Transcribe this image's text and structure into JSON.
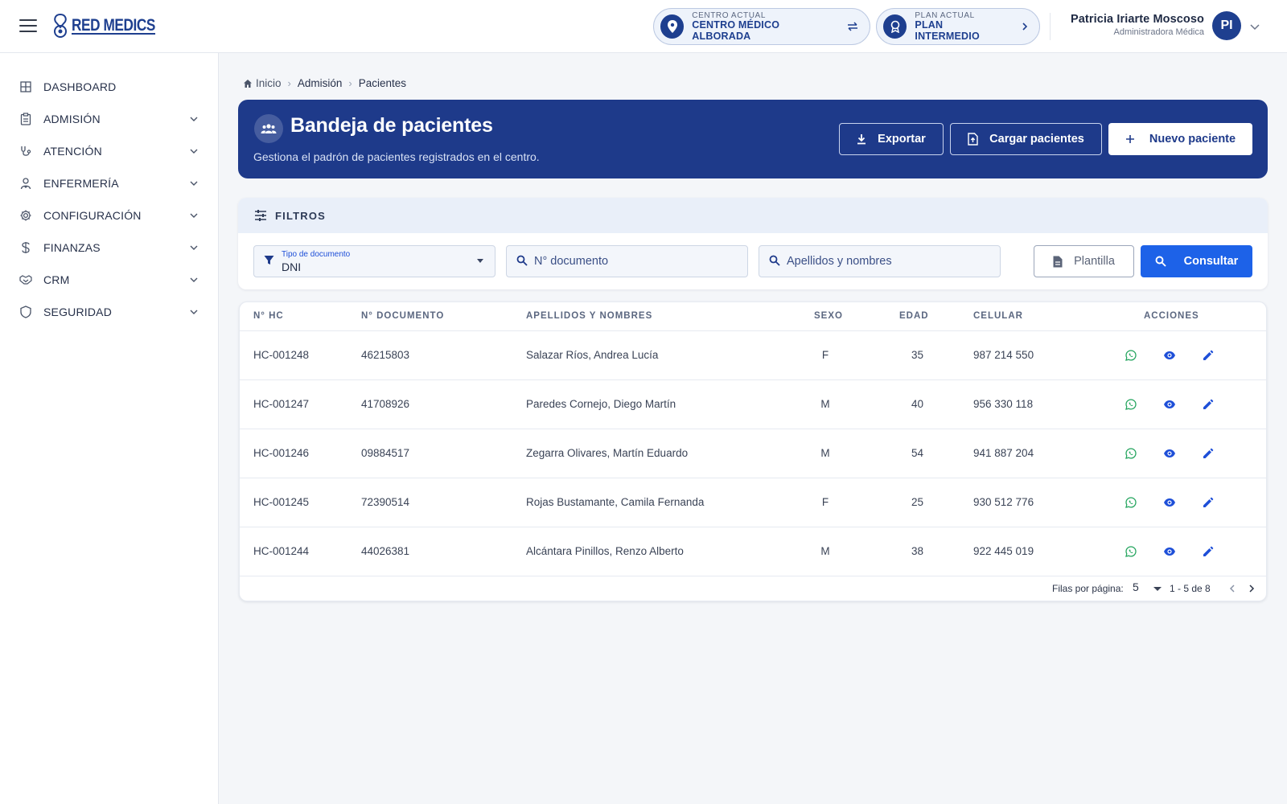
{
  "header": {
    "logo_text": "RED MEDICS",
    "center": {
      "label": "CENTRO ACTUAL",
      "value": "CENTRO MÉDICO ALBORADA"
    },
    "plan": {
      "label": "PLAN ACTUAL",
      "value": "PLAN INTERMEDIO"
    },
    "user": {
      "name": "Patricia Iriarte Moscoso",
      "role": "Administradora Médica",
      "initials": "PI"
    }
  },
  "sidebar": {
    "items": [
      {
        "label": "DASHBOARD",
        "icon": "grid-icon"
      },
      {
        "label": "ADMISIÓN",
        "icon": "clipboard-icon"
      },
      {
        "label": "ATENCIÓN",
        "icon": "stethoscope-icon"
      },
      {
        "label": "ENFERMERÍA",
        "icon": "nurse-icon"
      },
      {
        "label": "CONFIGURACIÓN",
        "icon": "gear-icon"
      },
      {
        "label": "FINANZAS",
        "icon": "dollar-icon"
      },
      {
        "label": "CRM",
        "icon": "handshake-icon"
      },
      {
        "label": "SEGURIDAD",
        "icon": "shield-icon"
      }
    ]
  },
  "breadcrumb": {
    "home": "Inicio",
    "section": "Admisión",
    "current": "Pacientes"
  },
  "hero": {
    "title": "Bandeja de pacientes",
    "subtitle": "Gestiona el padrón de pacientes registrados en el centro.",
    "export_label": "Exportar",
    "upload_label": "Cargar pacientes",
    "new_label": "Nuevo paciente"
  },
  "filters": {
    "title": "FILTROS",
    "doc_type_label": "Tipo de documento",
    "doc_type_value": "DNI",
    "doc_number_placeholder": "N° documento",
    "names_placeholder": "Apellidos y nombres",
    "template_label": "Plantilla",
    "search_label": "Consultar"
  },
  "table": {
    "columns": [
      "N° HC",
      "N° DOCUMENTO",
      "APELLIDOS Y NOMBRES",
      "SEXO",
      "EDAD",
      "CELULAR",
      "ACCIONES"
    ],
    "rows": [
      {
        "hc": "HC-001248",
        "doc": "46215803",
        "name": "Salazar Ríos, Andrea Lucía",
        "sex": "F",
        "age": "35",
        "phone": "987 214 550"
      },
      {
        "hc": "HC-001247",
        "doc": "41708926",
        "name": "Paredes Cornejo, Diego Martín",
        "sex": "M",
        "age": "40",
        "phone": "956 330 118"
      },
      {
        "hc": "HC-001246",
        "doc": "09884517",
        "name": "Zegarra Olivares, Martín Eduardo",
        "sex": "M",
        "age": "54",
        "phone": "941 887 204"
      },
      {
        "hc": "HC-001245",
        "doc": "72390514",
        "name": "Rojas Bustamante, Camila Fernanda",
        "sex": "F",
        "age": "25",
        "phone": "930 512 776"
      },
      {
        "hc": "HC-001244",
        "doc": "44026381",
        "name": "Alcántara Pinillos, Renzo Alberto",
        "sex": "M",
        "age": "38",
        "phone": "922 445 019"
      }
    ]
  },
  "pagination": {
    "rows_label": "Filas por página:",
    "rows_value": "5",
    "range": "1 - 5 de 8"
  },
  "colors": {
    "primary": "#1e3a8a",
    "accent": "#1d62e8",
    "whatsapp": "#25a55f"
  }
}
